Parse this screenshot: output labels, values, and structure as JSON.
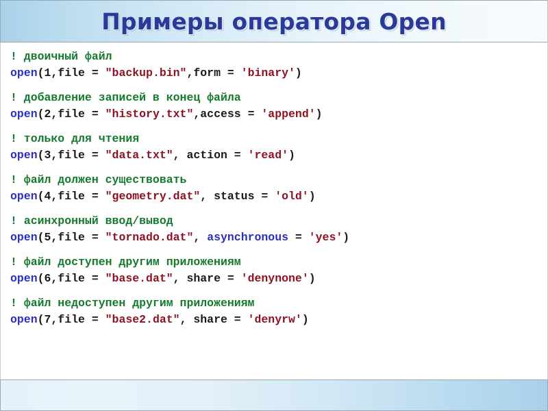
{
  "slide": {
    "title": "Примеры оператора Open",
    "colors": {
      "title_text": "#2b3a99",
      "header_gradient_start": "#a9d2ea",
      "header_gradient_end": "#f6fbfd",
      "footer_gradient_start": "#e4f2f9",
      "footer_gradient_end": "#a8d2ea",
      "comment": "#147a2e",
      "keyword": "#2b2fbe",
      "string": "#8f1222",
      "plain": "#1a1a1a",
      "background": "#ffffff"
    }
  },
  "code_blocks": [
    {
      "comment": "! двоичный файл",
      "tokens": [
        {
          "t": "open",
          "c": "kw"
        },
        {
          "t": "(1,file = ",
          "c": "plain"
        },
        {
          "t": "\"backup.bin\"",
          "c": "dq-str"
        },
        {
          "t": ",form = ",
          "c": "plain"
        },
        {
          "t": "'binary'",
          "c": "sq-str"
        },
        {
          "t": ")",
          "c": "plain"
        }
      ],
      "code_text": "open(1,file = \"backup.bin\",form = 'binary')"
    },
    {
      "comment": "! добавление записей в конец файла",
      "tokens": [
        {
          "t": "open",
          "c": "kw"
        },
        {
          "t": "(2,file = ",
          "c": "plain"
        },
        {
          "t": "\"history.txt\"",
          "c": "dq-str"
        },
        {
          "t": ",access = ",
          "c": "plain"
        },
        {
          "t": "'append'",
          "c": "sq-str"
        },
        {
          "t": ")",
          "c": "plain"
        }
      ],
      "code_text": "open(2,file = \"history.txt\",access = 'append')"
    },
    {
      "comment": "! только для чтения",
      "tokens": [
        {
          "t": "open",
          "c": "kw"
        },
        {
          "t": "(3,file = ",
          "c": "plain"
        },
        {
          "t": "\"data.txt\"",
          "c": "dq-str"
        },
        {
          "t": ", action = ",
          "c": "plain"
        },
        {
          "t": "'read'",
          "c": "sq-str"
        },
        {
          "t": ")",
          "c": "plain"
        }
      ],
      "code_text": "open(3,file = \"data.txt\", action = 'read')"
    },
    {
      "comment": "! файл должен существовать",
      "tokens": [
        {
          "t": "open",
          "c": "kw"
        },
        {
          "t": "(4,file = ",
          "c": "plain"
        },
        {
          "t": "\"geometry.dat\"",
          "c": "dq-str"
        },
        {
          "t": ", status = ",
          "c": "plain"
        },
        {
          "t": "'old'",
          "c": "sq-str"
        },
        {
          "t": ")",
          "c": "plain"
        }
      ],
      "code_text": "open(4,file = \"geometry.dat\", status = 'old')"
    },
    {
      "comment": "! асинхронный ввод/вывод",
      "tokens": [
        {
          "t": "open",
          "c": "kw"
        },
        {
          "t": "(5,file = ",
          "c": "plain"
        },
        {
          "t": "\"tornado.dat\"",
          "c": "dq-str"
        },
        {
          "t": ", ",
          "c": "plain"
        },
        {
          "t": "asynchronous",
          "c": "kw"
        },
        {
          "t": " = ",
          "c": "plain"
        },
        {
          "t": "'yes'",
          "c": "sq-str"
        },
        {
          "t": ")",
          "c": "plain"
        }
      ],
      "code_text": "open(5,file = \"tornado.dat\", asynchronous = 'yes')"
    },
    {
      "comment": "! файл доступен другим приложениям",
      "tokens": [
        {
          "t": "open",
          "c": "kw"
        },
        {
          "t": "(6,file = ",
          "c": "plain"
        },
        {
          "t": "\"base.dat\"",
          "c": "dq-str"
        },
        {
          "t": ", share = ",
          "c": "plain"
        },
        {
          "t": "'denynone'",
          "c": "sq-str"
        },
        {
          "t": ")",
          "c": "plain"
        }
      ],
      "code_text": "open(6,file = \"base.dat\", share = 'denynone')"
    },
    {
      "comment": "! файл недоступен другим приложениям",
      "tokens": [
        {
          "t": "open",
          "c": "kw"
        },
        {
          "t": "(7,file = ",
          "c": "plain"
        },
        {
          "t": "\"base2.dat\"",
          "c": "dq-str"
        },
        {
          "t": ", share = ",
          "c": "plain"
        },
        {
          "t": "'denyrw'",
          "c": "sq-str"
        },
        {
          "t": ")",
          "c": "plain"
        }
      ],
      "code_text": "open(7,file = \"base2.dat\", share = 'denyrw')"
    }
  ]
}
